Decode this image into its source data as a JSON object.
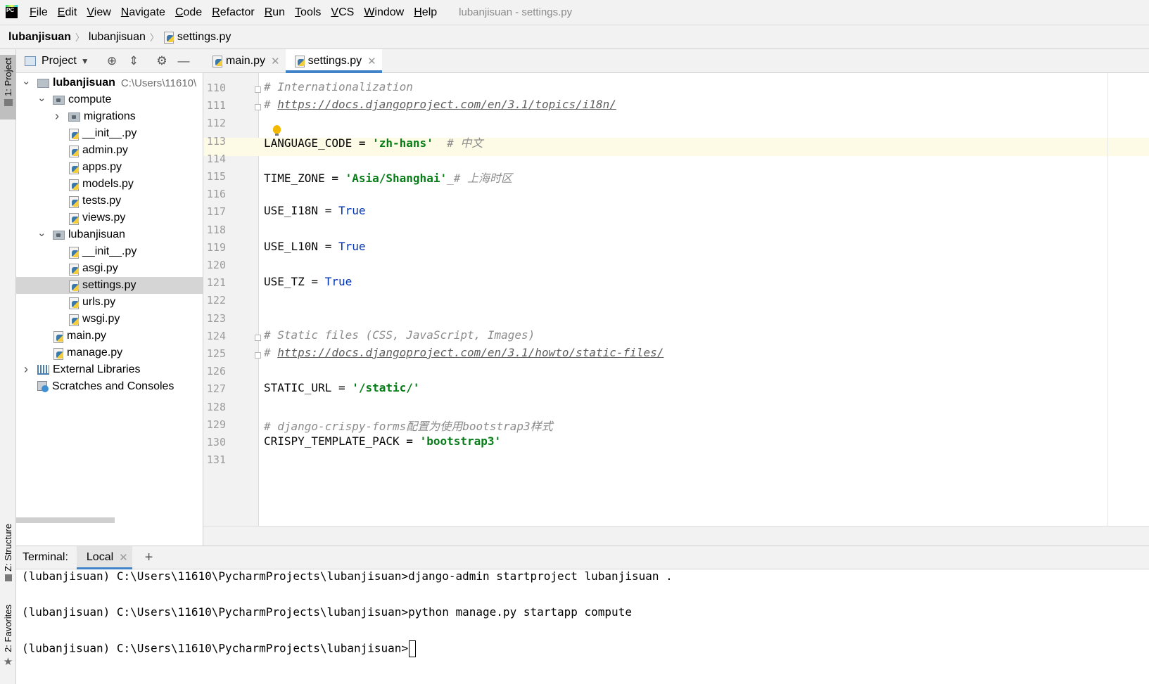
{
  "menu": {
    "items": [
      "File",
      "Edit",
      "View",
      "Navigate",
      "Code",
      "Refactor",
      "Run",
      "Tools",
      "VCS",
      "Window",
      "Help"
    ],
    "window_title": "lubanjisuan - settings.py"
  },
  "breadcrumb": {
    "items": [
      "lubanjisuan",
      "lubanjisuan",
      "settings.py"
    ]
  },
  "left_strip": {
    "project": "1: Project",
    "structure": "Z: Structure",
    "favorites": "2: Favorites"
  },
  "project_panel": {
    "title": "Project",
    "tree": [
      {
        "label": "lubanjisuan",
        "path": "C:\\Users\\11610\\",
        "kind": "folder",
        "depth": 0,
        "expanded": true
      },
      {
        "label": "compute",
        "kind": "package",
        "depth": 1,
        "expanded": true
      },
      {
        "label": "migrations",
        "kind": "package",
        "depth": 2,
        "expanded": false
      },
      {
        "label": "__init__.py",
        "kind": "py",
        "depth": 2
      },
      {
        "label": "admin.py",
        "kind": "py",
        "depth": 2
      },
      {
        "label": "apps.py",
        "kind": "py",
        "depth": 2
      },
      {
        "label": "models.py",
        "kind": "py",
        "depth": 2
      },
      {
        "label": "tests.py",
        "kind": "py",
        "depth": 2
      },
      {
        "label": "views.py",
        "kind": "py",
        "depth": 2
      },
      {
        "label": "lubanjisuan",
        "kind": "package",
        "depth": 1,
        "expanded": true
      },
      {
        "label": "__init__.py",
        "kind": "py",
        "depth": 2
      },
      {
        "label": "asgi.py",
        "kind": "py",
        "depth": 2
      },
      {
        "label": "settings.py",
        "kind": "py",
        "depth": 2,
        "selected": true
      },
      {
        "label": "urls.py",
        "kind": "py",
        "depth": 2
      },
      {
        "label": "wsgi.py",
        "kind": "py",
        "depth": 2
      },
      {
        "label": "main.py",
        "kind": "py",
        "depth": 1
      },
      {
        "label": "manage.py",
        "kind": "py",
        "depth": 1
      },
      {
        "label": "External Libraries",
        "kind": "lib",
        "depth": 0,
        "expanded": false
      },
      {
        "label": "Scratches and Consoles",
        "kind": "scratch",
        "depth": 0
      }
    ]
  },
  "editor": {
    "tabs": [
      {
        "label": "main.py",
        "active": false
      },
      {
        "label": "settings.py",
        "active": true
      }
    ],
    "caret_line": "113",
    "lines": [
      {
        "num": "110",
        "tokens": [
          {
            "t": "comment",
            "v": "# Internationalization"
          }
        ]
      },
      {
        "num": "111",
        "tokens": [
          {
            "t": "comment",
            "v": "# "
          },
          {
            "t": "link",
            "v": "https://docs.djangoproject.com/en/3.1/topics/i18n/"
          }
        ]
      },
      {
        "num": "112",
        "tokens": []
      },
      {
        "num": "113",
        "tokens": [
          {
            "t": "plain",
            "v": "LANGUAGE_CODE = "
          },
          {
            "t": "string",
            "v": "'zh-hans'"
          },
          {
            "t": "plain",
            "v": "  "
          },
          {
            "t": "comment",
            "v": "# 中文"
          }
        ]
      },
      {
        "num": "114",
        "tokens": []
      },
      {
        "num": "115",
        "tokens": [
          {
            "t": "plain",
            "v": "TIME_ZONE = "
          },
          {
            "t": "string",
            "v": "'Asia/Shanghai'"
          },
          {
            "t": "comment",
            "v": "_# 上海时区"
          }
        ]
      },
      {
        "num": "116",
        "tokens": []
      },
      {
        "num": "117",
        "tokens": [
          {
            "t": "plain",
            "v": "USE_I18N = "
          },
          {
            "t": "kw",
            "v": "True"
          }
        ]
      },
      {
        "num": "118",
        "tokens": []
      },
      {
        "num": "119",
        "tokens": [
          {
            "t": "plain",
            "v": "USE_L10N = "
          },
          {
            "t": "kw",
            "v": "True"
          }
        ]
      },
      {
        "num": "120",
        "tokens": []
      },
      {
        "num": "121",
        "tokens": [
          {
            "t": "plain",
            "v": "USE_TZ = "
          },
          {
            "t": "kw",
            "v": "True"
          }
        ]
      },
      {
        "num": "122",
        "tokens": []
      },
      {
        "num": "123",
        "tokens": []
      },
      {
        "num": "124",
        "tokens": [
          {
            "t": "comment",
            "v": "# Static files (CSS, JavaScript, Images)"
          }
        ]
      },
      {
        "num": "125",
        "tokens": [
          {
            "t": "comment",
            "v": "# "
          },
          {
            "t": "link",
            "v": "https://docs.djangoproject.com/en/3.1/howto/static-files/"
          }
        ]
      },
      {
        "num": "126",
        "tokens": []
      },
      {
        "num": "127",
        "tokens": [
          {
            "t": "plain",
            "v": "STATIC_URL = "
          },
          {
            "t": "string",
            "v": "'/static/'"
          }
        ]
      },
      {
        "num": "128",
        "tokens": []
      },
      {
        "num": "129",
        "tokens": [
          {
            "t": "comment",
            "v": "# django-crispy-forms配置为使用bootstrap3样式"
          }
        ]
      },
      {
        "num": "130",
        "tokens": [
          {
            "t": "plain",
            "v": "CRISPY_TEMPLATE_PACK = "
          },
          {
            "t": "string",
            "v": "'bootstrap3'"
          }
        ]
      },
      {
        "num": "131",
        "tokens": []
      }
    ]
  },
  "terminal": {
    "label": "Terminal:",
    "tab": "Local",
    "lines": [
      "(lubanjisuan) C:\\Users\\11610\\PycharmProjects\\lubanjisuan>django-admin startproject lubanjisuan .",
      "(lubanjisuan) C:\\Users\\11610\\PycharmProjects\\lubanjisuan>python manage.py startapp compute",
      "(lubanjisuan) C:\\Users\\11610\\PycharmProjects\\lubanjisuan>"
    ]
  },
  "colors": {
    "accent": "#4083c9",
    "string": "#067d17",
    "keyword": "#0033b3",
    "comment": "#8c8c8c",
    "caret_line": "#fdfbe6",
    "chrome": "#f2f2f2"
  },
  "icons": {
    "app": "pycharm-logo",
    "locate": "crosshair-icon",
    "collapse": "collapse-all-icon",
    "settings": "gear-icon",
    "hide": "minimize-icon",
    "intention": "lightbulb-icon"
  }
}
